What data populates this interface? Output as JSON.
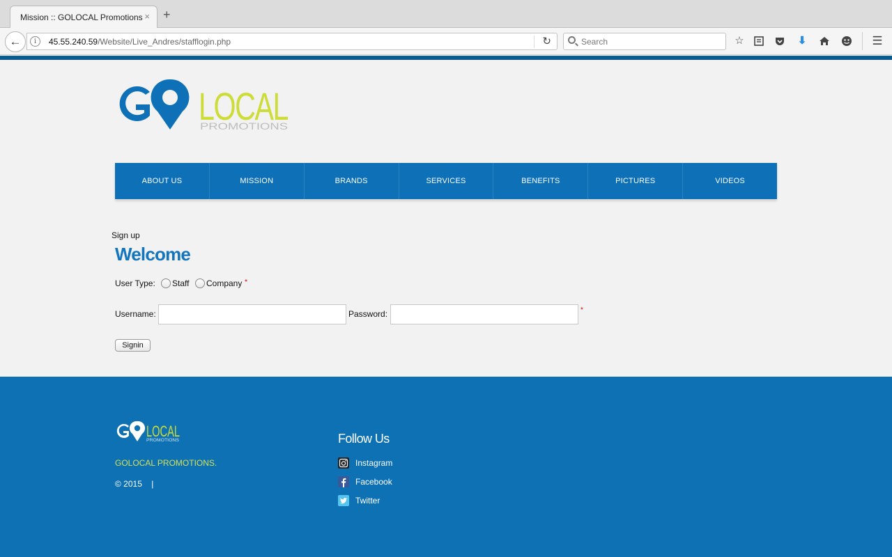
{
  "browser": {
    "tab_title": "Mission :: GOLOCAL Promotions",
    "tab_close": "×",
    "new_tab": "+",
    "url_host": "45.55.240.59",
    "url_path": "/Website/Live_Andres/stafflogin.php",
    "search_placeholder": "Search",
    "toolbar_icons": [
      "back-icon",
      "info-icon",
      "reload-icon",
      "bookmark-star-icon",
      "reading-list-icon",
      "pocket-icon",
      "download-icon",
      "home-icon",
      "smiley-icon",
      "hamburger-menu-icon"
    ]
  },
  "site": {
    "logo_go": "GO",
    "logo_local": "LOCAL",
    "logo_promotions": "PROMOTIONS",
    "menu": [
      "ABOUT US",
      "MISSION",
      "BRANDS",
      "SERVICES",
      "BENEFITS",
      "PICTURES",
      "VIDEOS"
    ],
    "brand_colors": {
      "blue": "#0e71b7",
      "lime": "#cddc39",
      "gray": "#bdbdbd"
    }
  },
  "form": {
    "signup_label": "Sign up",
    "heading": "Welcome",
    "user_type_label": "User Type:",
    "option_staff": "Staff",
    "option_company": "Company",
    "required_mark": "*",
    "username_label": "Username:",
    "username_value": "",
    "password_label": "Password:",
    "password_value": "",
    "signin_label": "Signin"
  },
  "footer": {
    "company": "GOLOCAL PROMOTIONS.",
    "copyright": "© 2015    |",
    "follow_title": "Follow Us",
    "social": [
      {
        "label": "Instagram",
        "icon": "instagram-icon"
      },
      {
        "label": "Facebook",
        "icon": "facebook-icon"
      },
      {
        "label": "Twitter",
        "icon": "twitter-icon"
      }
    ]
  }
}
